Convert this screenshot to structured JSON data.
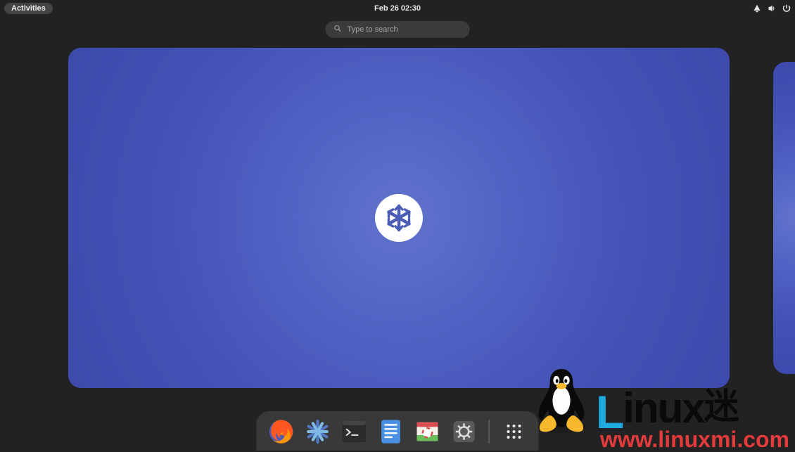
{
  "topbar": {
    "activities_label": "Activities",
    "clock": "Feb 26  02:30"
  },
  "search": {
    "placeholder": "Type to search"
  },
  "system_tray": {
    "network_icon": "network-wired",
    "volume_icon": "volume",
    "power_icon": "power"
  },
  "workspaces": [
    {
      "id": 1,
      "wallpaper": "nixos-blue",
      "active": true
    },
    {
      "id": 2,
      "wallpaper": "nixos-blue",
      "active": false
    }
  ],
  "dock": {
    "items": [
      {
        "name": "firefox",
        "label": "Firefox"
      },
      {
        "name": "nixos",
        "label": "NixOS Configuration"
      },
      {
        "name": "terminal",
        "label": "Terminal"
      },
      {
        "name": "files",
        "label": "Files"
      },
      {
        "name": "help",
        "label": "Help"
      },
      {
        "name": "settings",
        "label": "Settings"
      }
    ],
    "show_apps_label": "Show Applications"
  },
  "watermark": {
    "title_main": "Linux",
    "title_suffix": "迷",
    "url": "www.linuxmi.com"
  }
}
